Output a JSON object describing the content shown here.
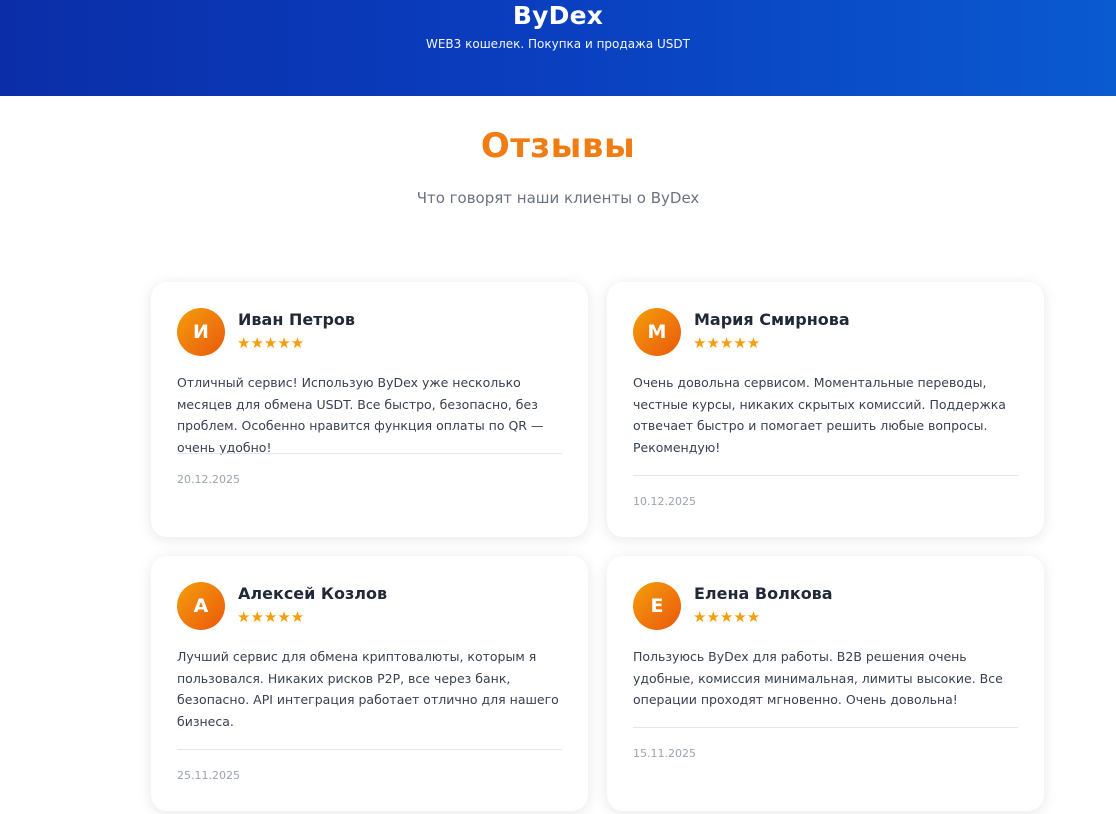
{
  "header": {
    "brand": "ByDex",
    "tagline": "WEB3 кошелек. Покупка и продажа USDT"
  },
  "section": {
    "title": "Отзывы",
    "subtitle": "Что говорят наши клиенты о ByDex"
  },
  "colors": {
    "header_gradient_start": "#0b2ea8",
    "header_gradient_end": "#0a5ad0",
    "accent": "#f07c14",
    "star": "#f59e0b"
  },
  "reviews": [
    {
      "initial": "И",
      "name": "Иван Петров",
      "stars": "★★★★★",
      "rating": 5,
      "text": "Отличный сервис! Использую ByDex уже несколько месяцев для обмена USDT. Все быстро, безопасно, без проблем. Особенно нравится функция оплаты по QR — очень удобно!",
      "date": "20.12.2025"
    },
    {
      "initial": "М",
      "name": "Мария Смирнова",
      "stars": "★★★★★",
      "rating": 5,
      "text": "Очень довольна сервисом. Моментальные переводы, честные курсы, никаких скрытых комиссий. Поддержка отвечает быстро и помогает решить любые вопросы. Рекомендую!",
      "date": "10.12.2025"
    },
    {
      "initial": "А",
      "name": "Алексей Козлов",
      "stars": "★★★★★",
      "rating": 5,
      "text": "Лучший сервис для обмена криптовалюты, которым я пользовался. Никаких рисков P2P, все через банк, безопасно. API интеграция работает отлично для нашего бизнеса.",
      "date": "25.11.2025"
    },
    {
      "initial": "Е",
      "name": "Елена Волкова",
      "stars": "★★★★★",
      "rating": 5,
      "text": "Пользуюсь ByDex для работы. B2B решения очень удобные, комиссия минимальная, лимиты высокие. Все операции проходят мгновенно. Очень довольна!",
      "date": "15.11.2025"
    }
  ]
}
